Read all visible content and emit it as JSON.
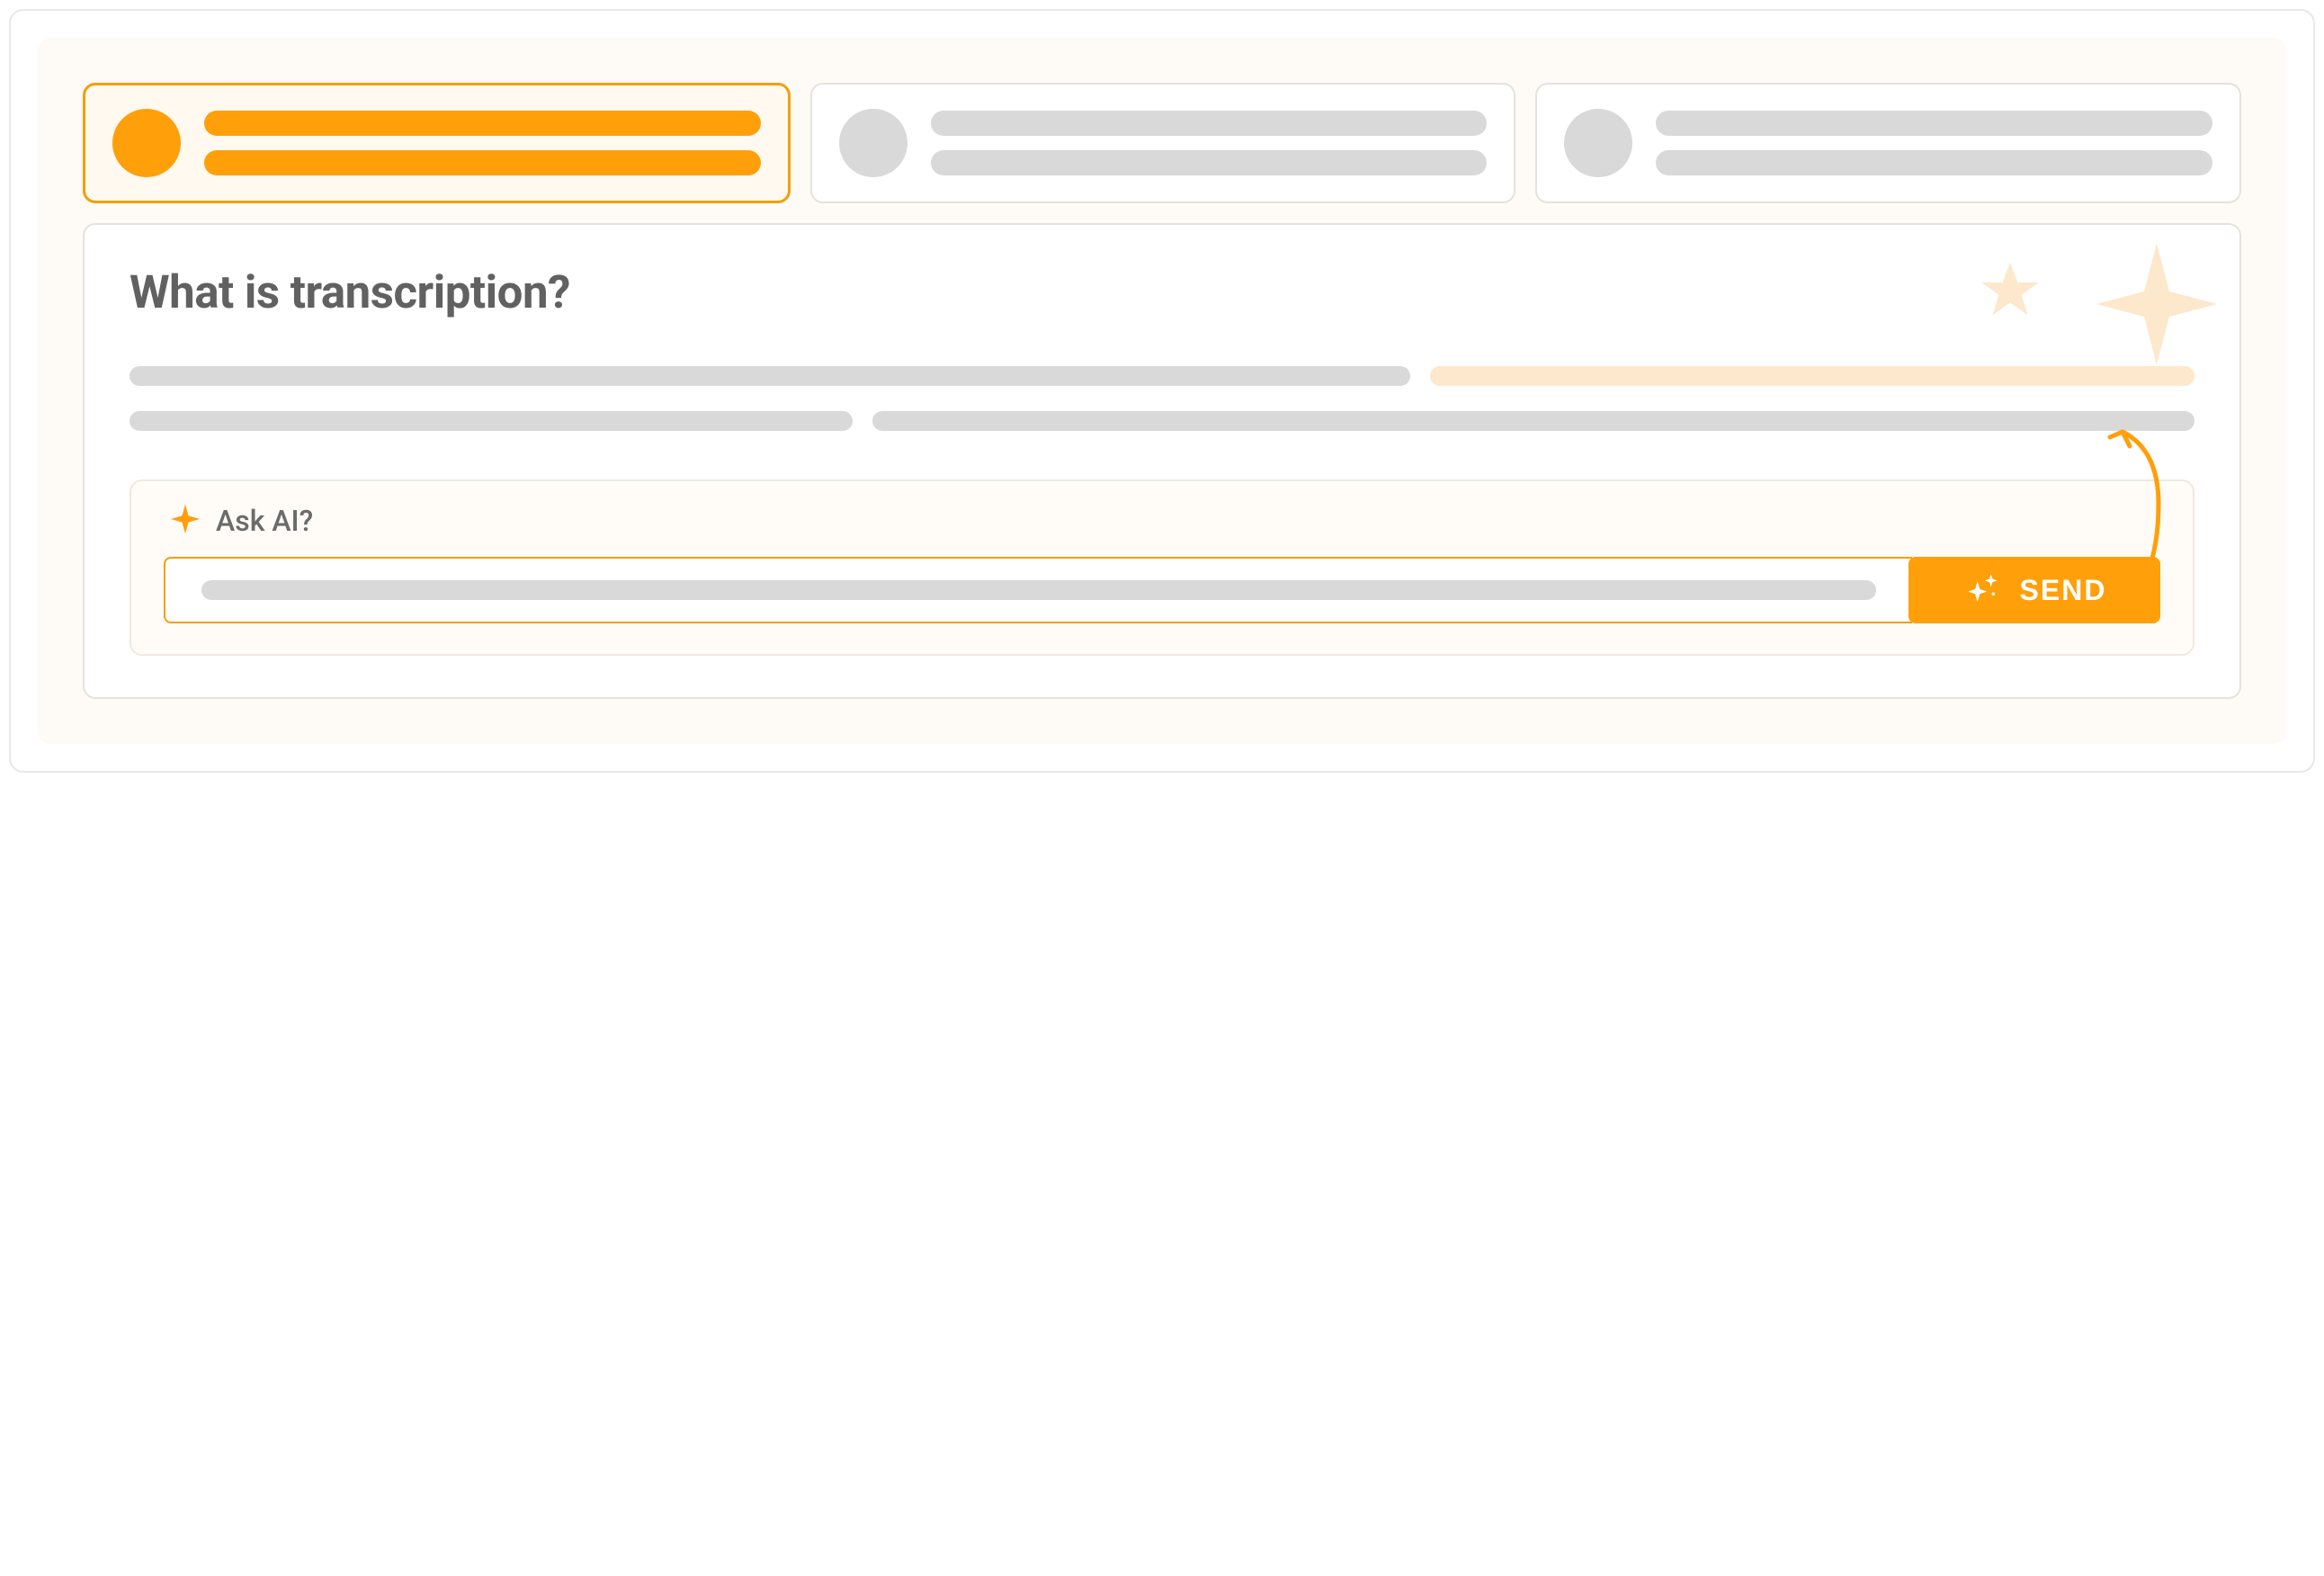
{
  "colors": {
    "accent": "#FF9F0A",
    "accent_border": "#F59E0B",
    "accent_light": "#FDE8CC",
    "muted": "#d9d9d9",
    "text_heading": "#616161",
    "text_muted": "#6b6b6b",
    "panel_bg": "#FEFAF5",
    "ask_bg": "#FFFCF7"
  },
  "tabs": [
    {
      "active": true
    },
    {
      "active": false
    },
    {
      "active": false
    }
  ],
  "main": {
    "heading": "What is transcription?"
  },
  "ask": {
    "title": "Ask AI?",
    "send_label": "SEND"
  },
  "icons": {
    "sparkle": "sparkle-icon",
    "star_large": "star-large-icon",
    "star_small": "star-small-icon",
    "sparkles_btn": "sparkles-icon"
  }
}
